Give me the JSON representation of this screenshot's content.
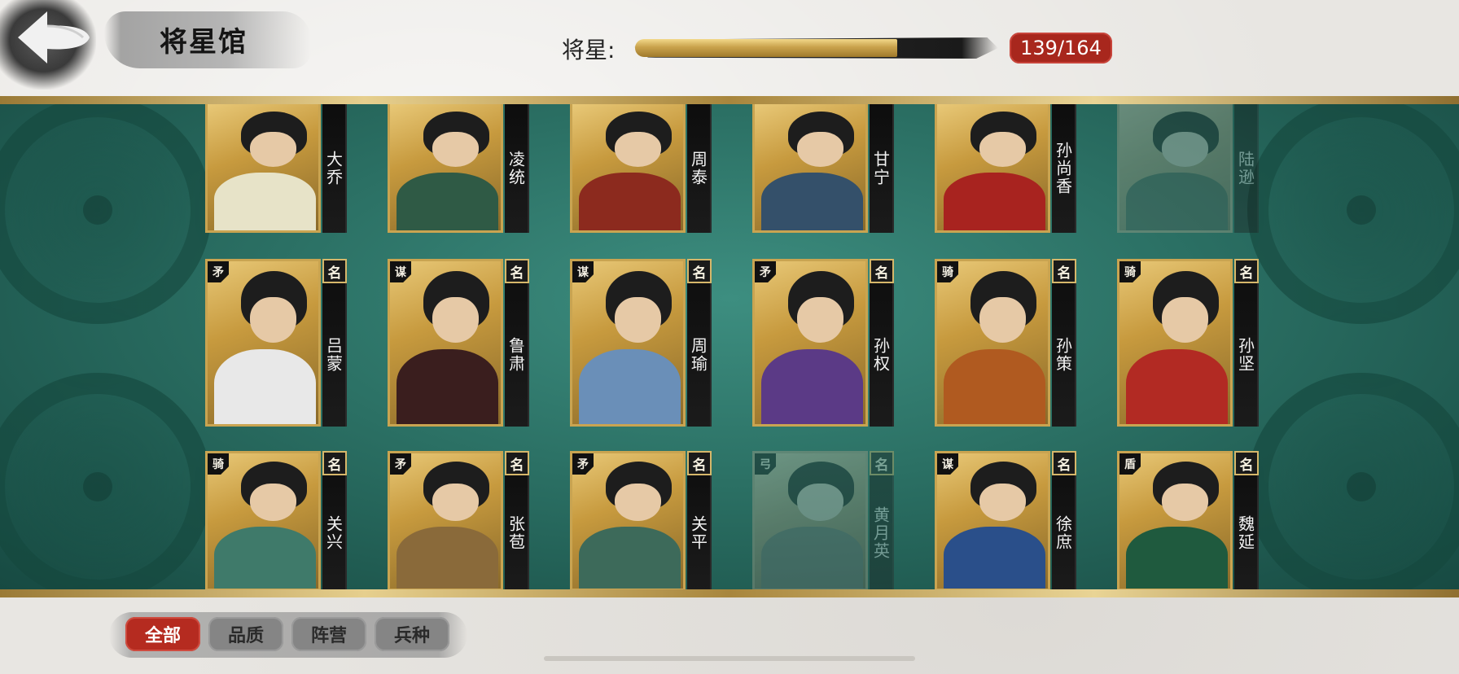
{
  "header": {
    "title": "将星馆",
    "progress_label": "将星:",
    "progress_text": "139/164",
    "progress_fraction": 0.848
  },
  "tabs": [
    {
      "label": "全部",
      "active": true
    },
    {
      "label": "品质",
      "active": false
    },
    {
      "label": "阵营",
      "active": false
    },
    {
      "label": "兵种",
      "active": false
    }
  ],
  "cards": {
    "row1": [
      {
        "name": "大乔",
        "locked": false,
        "robe": "#e7e3c8"
      },
      {
        "name": "凌统",
        "locked": false,
        "robe": "#2f5a45"
      },
      {
        "name": "周泰",
        "locked": false,
        "robe": "#8c2a1e"
      },
      {
        "name": "甘宁",
        "locked": false,
        "robe": "#34506a"
      },
      {
        "name": "孙尚香",
        "locked": false,
        "robe": "#a8231f"
      },
      {
        "name": "陆逊",
        "locked": true,
        "robe": "#2e6a4a"
      }
    ],
    "row2": [
      {
        "name": "吕蒙",
        "class": "矛",
        "badge": "名",
        "locked": false,
        "robe": "#e8e8e8"
      },
      {
        "name": "鲁肃",
        "class": "谋",
        "badge": "名",
        "locked": false,
        "robe": "#3a1e1e"
      },
      {
        "name": "周瑜",
        "class": "谋",
        "badge": "名",
        "locked": false,
        "robe": "#6a8fb8"
      },
      {
        "name": "孙权",
        "class": "矛",
        "badge": "名",
        "locked": false,
        "robe": "#5b3a86"
      },
      {
        "name": "孙策",
        "class": "骑",
        "badge": "名",
        "locked": false,
        "robe": "#b05a20"
      },
      {
        "name": "孙坚",
        "class": "骑",
        "badge": "名",
        "locked": false,
        "robe": "#b22a23"
      }
    ],
    "row3": [
      {
        "name": "关兴",
        "class": "骑",
        "badge": "名",
        "locked": false,
        "robe": "#3f7a6a"
      },
      {
        "name": "张苞",
        "class": "矛",
        "badge": "名",
        "locked": false,
        "robe": "#8a6a3a"
      },
      {
        "name": "关平",
        "class": "矛",
        "badge": "名",
        "locked": false,
        "robe": "#3d6a5a"
      },
      {
        "name": "黄月英",
        "class": "弓",
        "badge": "名",
        "locked": true,
        "robe": "#6a7a70"
      },
      {
        "name": "徐庶",
        "class": "谋",
        "badge": "名",
        "locked": false,
        "robe": "#2a4f8a"
      },
      {
        "name": "魏延",
        "class": "盾",
        "badge": "名",
        "locked": false,
        "robe": "#1f5a3e"
      }
    ]
  }
}
